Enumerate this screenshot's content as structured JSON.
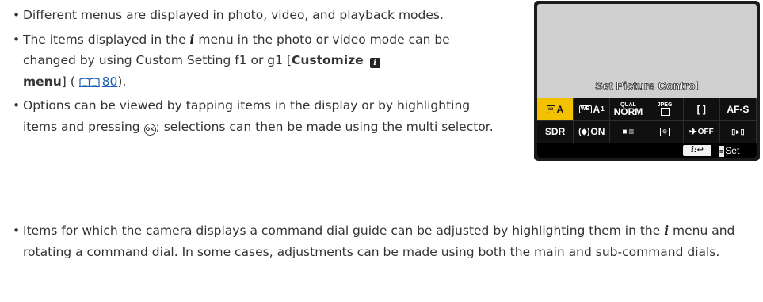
{
  "bullets_top": {
    "b1": "Different menus are displayed in photo, video, and playback modes.",
    "b2_a": "The items displayed in the ",
    "i_label": "i",
    "b2_b": " menu in the photo or video mode can be changed by using Custom Setting f1 or g1 [",
    "b2_bold": "Customize",
    "b2_bold2": "menu",
    "b2_c": "] ( ",
    "b2_page": "80",
    "b2_d": ").",
    "b3_a": "Options can be viewed by tapping items in the display or by highlighting items and pressing ",
    "b3_b": "; selections can then be made using the multi selector."
  },
  "bullets_bottom": {
    "b4_a": "Items for which the camera displays a command dial guide can be adjusted by highlighting them in the ",
    "b4_b": " menu and rotating a command dial. In some cases, adjustments can be made using both the main and sub-command dials."
  },
  "camera_screen": {
    "title": "Set Picture Control",
    "row1": {
      "c1": "A",
      "c2": "A",
      "c2_sub": "1",
      "c3_top": "QUAL",
      "c3": "NORM",
      "c4_top": "JPEG",
      "c5": "[ ]",
      "c6": "AF-S"
    },
    "row2": {
      "c1": "SDR",
      "c2": "ON",
      "c3": "≡",
      "c4": "⊙",
      "c5": "OFF",
      "c6": "▸"
    },
    "hints": {
      "i_label": "i",
      "set_label": "Set"
    }
  },
  "colors": {
    "text": "#333333",
    "link": "#1a5fb4",
    "highlight": "#f2c200",
    "camera_bg": "#cfcfcf"
  }
}
